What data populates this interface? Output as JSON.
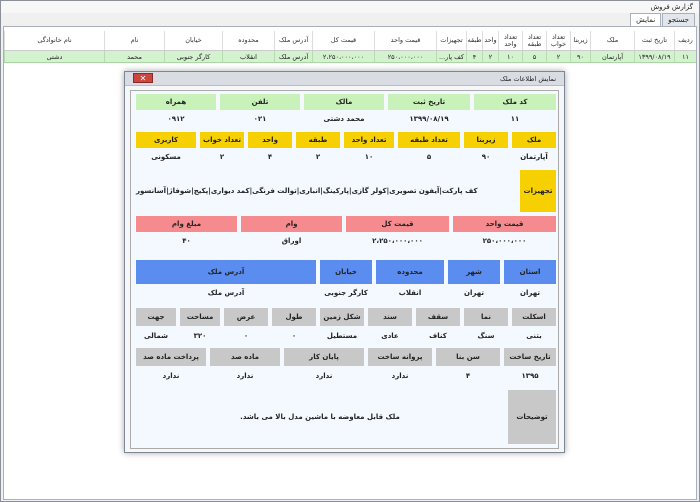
{
  "window": {
    "title": "گزارش فروش"
  },
  "tabs": [
    "جستجو",
    "نمایش"
  ],
  "grid": {
    "headers": [
      "ردیف",
      "تاریخ ثبت",
      "ملک",
      "زیربنا",
      "تعداد خواب",
      "تعداد طبقه",
      "تعداد واحد",
      "واحد",
      "طبقه",
      "تجهیزات",
      "قیمت واحد",
      "قیمت کل",
      "آدرس ملک",
      "محدوده",
      "خیابان",
      "نام",
      "نام خانوادگی"
    ],
    "row": [
      "۱۱",
      "۱۳۹۹/۰۸/۱۹",
      "آپارتمان",
      "۹۰",
      "۲",
      "۵",
      "۱۰",
      "۲",
      "۴",
      "کف پار...",
      "۲۵۰،۰۰۰،۰۰۰",
      "۲،۲۵۰،۰۰۰،۰۰۰",
      "آدرس ملک",
      "انقلاب",
      "کارگر جنوبی",
      "محمد",
      "دشتی"
    ]
  },
  "dialog": {
    "title": "نمایش اطلاعات ملک",
    "close": "✕",
    "r1": {
      "labels": [
        "کد ملک",
        "تاریخ ثبت",
        "مالک",
        "تلفن",
        "همراه"
      ],
      "values": [
        "۱۱",
        "۱۳۹۹/۰۸/۱۹",
        "محمد دشتی",
        "۰۲۱",
        "۰۹۱۲"
      ]
    },
    "r2": {
      "labels": [
        "ملک",
        "زیربنا",
        "تعداد طبقه",
        "تعداد واحد",
        "طبقه",
        "واحد",
        "تعداد خواب",
        "کاربری"
      ],
      "values": [
        "آپارتمان",
        "۹۰",
        "۵",
        "۱۰",
        "۲",
        "۴",
        "۲",
        "مسکونی"
      ]
    },
    "equip": {
      "label": "تجهیزات",
      "value": "کف پارکت|آیفون تصویری|کولر گازی|پارکینگ|انباری|توالت فرنگی|کمد دیواری|پکیج|شوفاژ|آسانسور"
    },
    "price": {
      "labels": [
        "قیمت واحد",
        "قیمت کل",
        "وام",
        "مبلغ وام"
      ],
      "values": [
        "۲۵۰،۰۰۰،۰۰۰",
        "۲،۲۵۰،۰۰۰،۰۰۰",
        "اوراق",
        "۴۰"
      ]
    },
    "addr": {
      "labels": [
        "استان",
        "شهر",
        "محدوده",
        "خیابان",
        "آدرس ملک"
      ],
      "values": [
        "تهران",
        "تهران",
        "انقلاب",
        "کارگر جنوبی",
        "آدرس ملک"
      ]
    },
    "r5": {
      "labels": [
        "اسکلت",
        "نما",
        "سقف",
        "سند",
        "شکل زمین",
        "طول",
        "عرض",
        "مساحت",
        "جهت"
      ],
      "values": [
        "بتنی",
        "سنگ",
        "کناف",
        "عادی",
        "مستطیل",
        "۰",
        "۰",
        "۳۲۰",
        "شمالی"
      ]
    },
    "r6": {
      "labels": [
        "تاریخ ساخت",
        "سن بنا",
        "پروانه ساخت",
        "پایان کار",
        "ماده صد",
        "پرداخت ماده صد"
      ],
      "values": [
        "۱۳۹۵",
        "۴",
        "ندارد",
        "ندارد",
        "ندارد",
        "ندارد"
      ]
    },
    "notes": {
      "label": "توضیحات",
      "value": "ملک قابل معاوضه با ماشین مدل بالا می باشد."
    }
  },
  "colors": {
    "green": "#c8f2b9",
    "yellow": "#f6d000",
    "red": "#f58b8e",
    "blue": "#5b8cf0",
    "gray": "#c8c8c8",
    "row": "#d5f2d0"
  }
}
